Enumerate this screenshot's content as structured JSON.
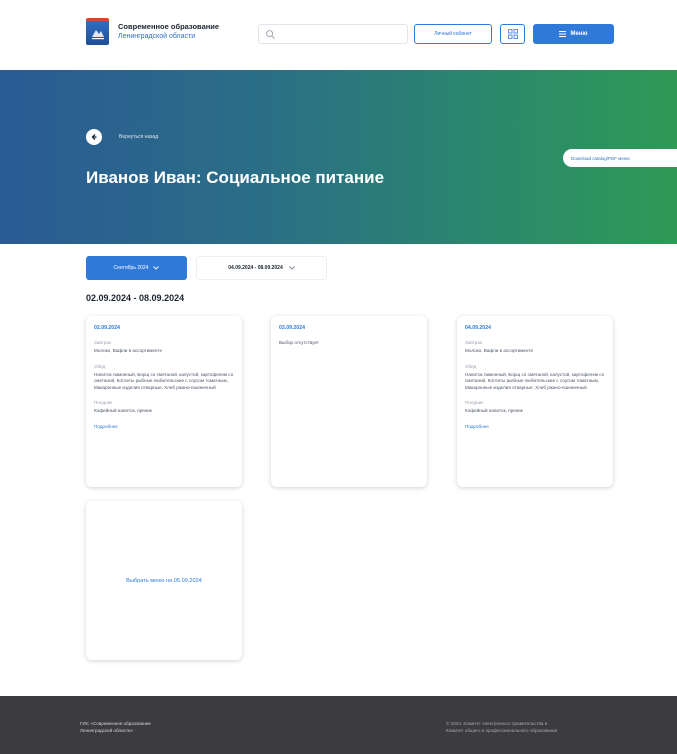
{
  "header": {
    "logo_title": "Современное образование",
    "logo_subtitle": "Ленинградской области",
    "search_placeholder": "",
    "cabinet_label": "Личный кабинет",
    "menu_label": "Меню"
  },
  "hero": {
    "back_label": "Вернуться назад",
    "title": "Иванов Иван: Социальное питание",
    "download_label": "Download catalog/PDF меню"
  },
  "filters": {
    "month_label": "Сентябрь 2024",
    "week_label": "04.09.2024 - 08.09.2024"
  },
  "week_heading": "02.09.2024 - 08.09.2024",
  "cards": [
    {
      "date": "02.09.2024",
      "breakfast_title": "Завтрак",
      "breakfast_text": "Молоко, Вафли в ассортименте",
      "lunch_title": "Обед",
      "lunch_text": "Напиток лимонный, Борщ со сметаной, капустой, картофелем со сметаной, Котлеты рыбные любительские с соусом томатным, Макаронные изделия отварные, Хлеб ржано-пшеничный",
      "snack_title": "Полдник",
      "snack_text": "Кофейный напиток, пряник",
      "more_label": "Подробнее"
    },
    {
      "date": "03.09.2024",
      "note": "Выбор отсутствует"
    },
    {
      "date": "04.09.2024",
      "breakfast_title": "Завтрак",
      "breakfast_text": "Молоко, Вафли в ассортименте",
      "lunch_title": "Обед",
      "lunch_text": "Напиток лимонный, Борщ со сметаной, капустой, картофелем со сметаной, Котлеты рыбные любительские с соусом томатным, Макаронные изделия отварные, Хлеб ржано-пшеничный",
      "snack_title": "Полдник",
      "snack_text": "Кофейный напиток, пряник",
      "more_label": "Подробнее"
    },
    {
      "select_label": "Выбрать меню на 05.09.2024"
    }
  ],
  "footer": {
    "left_line1": "ГИС «Современное образование",
    "left_line2": "Ленинградской области»",
    "right_line1": "© 2024. Комитет электронного правительства и",
    "right_line2": "Комитет общего и профессионального образования"
  },
  "colors": {
    "accent": "#2f7ad8",
    "hero_start": "#2a5b94",
    "hero_end": "#2e9a55",
    "footer": "#3c3c3f"
  }
}
